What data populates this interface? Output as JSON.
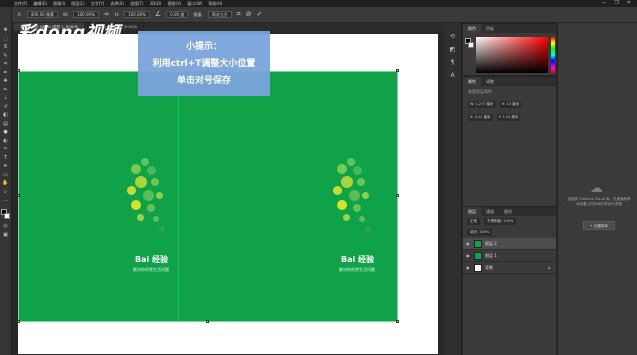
{
  "menu": [
    "文件(F)",
    "编辑(E)",
    "图像(I)",
    "图层(L)",
    "文字(Y)",
    "选择(S)",
    "滤镜(T)",
    "3D(D)",
    "视图(V)",
    "窗口(W)",
    "帮助(H)"
  ],
  "window_controls": [
    "—",
    "❐",
    "✕"
  ],
  "options_bar": {
    "x_label": "X:",
    "x_value": "400.00 像素",
    "w_label": "W:",
    "w_value": "100.00%",
    "h_label": "H:",
    "h_value": "100.00%",
    "angle_value": "0.00 度",
    "interp_label": "插值:",
    "interp_value": "两次立方",
    "cancel_icon": "cancel-icon",
    "commit_icon": "check-icon"
  },
  "tabs": [
    "未标题-1 @ 56.3% (图层 1, RGB/8)",
    "timg.jpg @ 66.7% (RGB/8)"
  ],
  "watermark": "彩dong视频",
  "tip": {
    "line1": "小提示：",
    "line2": "利用ctrl+T调整大小位置",
    "line3": "单击对号保存"
  },
  "logo": {
    "brand": "Bai 经验",
    "sub": "解决你的常生活问题"
  },
  "panels": {
    "color_tabs": [
      "颜色",
      "色板"
    ],
    "props_tabs": [
      "属性",
      "调整"
    ],
    "props_title": "像素图层属性",
    "props_w": "W: 1,277 厘米",
    "props_h": "H: 13 厘米",
    "props_x": "X: 4.12 厘米",
    "props_y": "Y: 1.24 厘米",
    "layers_tabs": [
      "图层",
      "通道",
      "路径"
    ],
    "blend_mode": "正常",
    "opacity": "不透明度: 100%",
    "fill": "填充: 100%",
    "layers": [
      {
        "name": "图层 2",
        "selected": true
      },
      {
        "name": "图层 1",
        "selected": false
      },
      {
        "name": "背景",
        "selected": false
      }
    ]
  },
  "library": {
    "text": "连接到 Creative Cloud 库，在桌面和移动设备上同步和共享设计资源",
    "button": "+ 创建新库"
  },
  "colors": {
    "green": "#0fa248",
    "tip_bg": "#7ba4dc",
    "ui_dark": "#282828"
  }
}
